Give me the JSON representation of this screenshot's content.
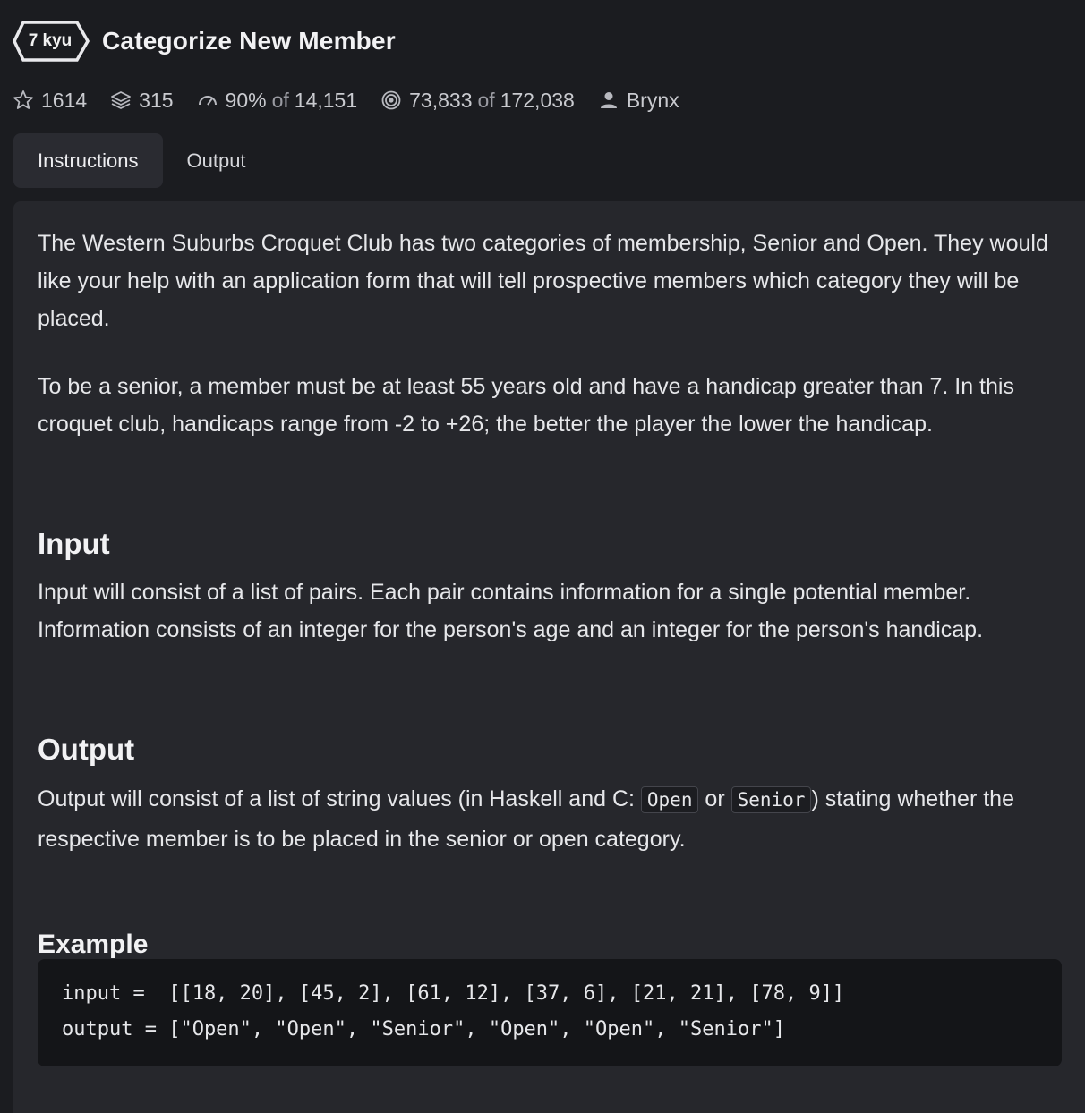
{
  "kata": {
    "rank": "7 kyu",
    "title": "Categorize New Member"
  },
  "stats": {
    "stars": "1614",
    "collections": "315",
    "satisfaction": "90%",
    "satisfaction_of": "of",
    "satisfaction_votes": "14,151",
    "completed": "73,833",
    "completed_of": "of",
    "attempts": "172,038",
    "author": "Brynx"
  },
  "tabs": [
    {
      "label": "Instructions",
      "active": true
    },
    {
      "label": "Output",
      "active": false
    }
  ],
  "description": {
    "p1": "The Western Suburbs Croquet Club has two categories of membership, Senior and Open. They would like your help with an application form that will tell prospective members which category they will be placed.",
    "p2": "To be a senior, a member must be at least 55 years old and have a handicap greater than 7. In this croquet club, handicaps range from -2 to +26; the better the player the lower the handicap.",
    "input_heading": "Input",
    "p3": "Input will consist of a list of pairs. Each pair contains information for a single potential member. Information consists of an integer for the person's age and an integer for the person's handicap.",
    "output_heading": "Output",
    "p4_before": "Output will consist of a list of string values (in Haskell and C: ",
    "code_open": "Open",
    "p4_or": " or ",
    "code_senior": "Senior",
    "p4_after": ") stating whether the respective member is to be placed in the senior or open category.",
    "example_heading": "Example",
    "example_input": "input =  [[18, 20], [45, 2], [61, 12], [37, 6], [21, 21], [78, 9]]",
    "example_output": "output = [\"Open\", \"Open\", \"Senior\", \"Open\", \"Open\", \"Senior\"]"
  },
  "icons": {
    "stars": "star-outline-icon",
    "collections": "stack-icon",
    "satisfaction": "gauge-icon",
    "completed": "target-icon",
    "author": "user-icon"
  },
  "colors": {
    "background": "#1b1c20",
    "panel": "#26272c",
    "active_tab": "#2a2b31",
    "code_block": "#141518"
  }
}
